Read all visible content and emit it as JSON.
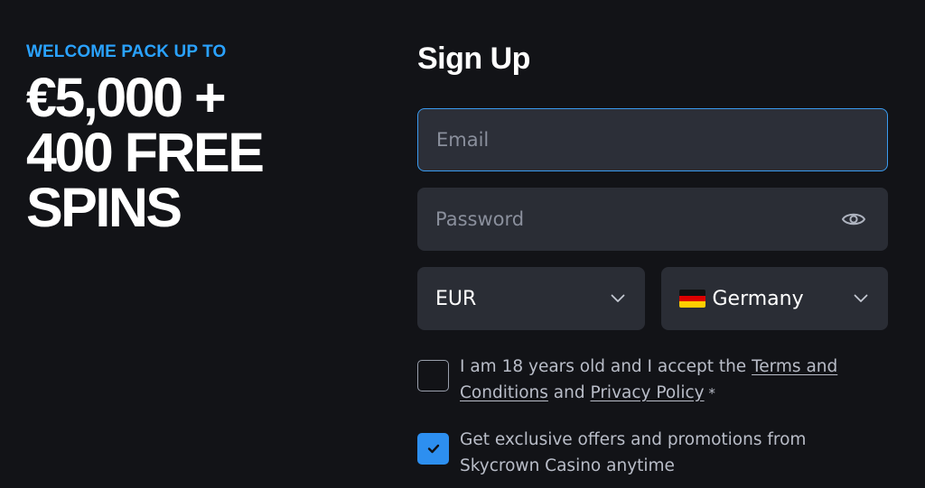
{
  "promo": {
    "kicker": "WELCOME PACK UP TO",
    "headline_lines": [
      "€5,000 +",
      "400 FREE",
      "SPINS"
    ]
  },
  "signup": {
    "title": "Sign Up",
    "email_placeholder": "Email",
    "password_placeholder": "Password",
    "currency": "EUR",
    "country": "Germany",
    "country_flag": "germany-flag-icon",
    "terms": {
      "prefix": "I am 18 years old and I accept the ",
      "terms_link": "Terms and Conditions",
      "middle": " and ",
      "privacy_link": "Privacy Policy",
      "required_mark": " *",
      "checked": false
    },
    "offers": {
      "text": "Get exclusive offers and promotions from Skycrown Casino anytime",
      "checked": true
    }
  },
  "colors": {
    "background": "#121317",
    "accent": "#2aa2ff",
    "field": "#2a2d35",
    "focus_border": "#3a9bf0",
    "checkbox_checked": "#2d8ff0"
  },
  "icons": {
    "password_toggle": "eye-icon",
    "dropdown": "chevron-down-icon",
    "checkmark": "check-icon"
  }
}
